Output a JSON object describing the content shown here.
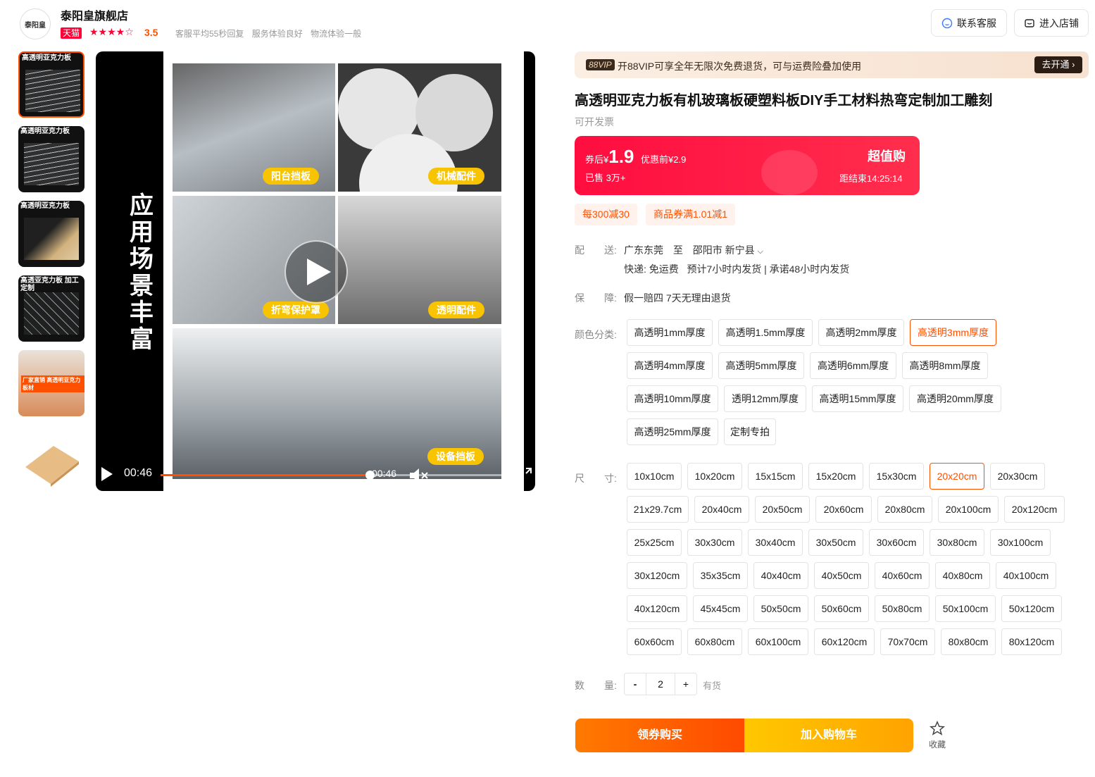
{
  "shop": {
    "logo_text": "泰阳皇",
    "name": "泰阳皇旗舰店",
    "badge": "天猫",
    "stars": "★★★★☆",
    "rating": "3.5",
    "service": [
      "客服平均55秒回复",
      "服务体验良好",
      "物流体验一般"
    ],
    "contact_label": "联系客服",
    "store_label": "进入店铺"
  },
  "thumbs": [
    {
      "title": "高透明亚克力板"
    },
    {
      "title": "高透明亚克力板"
    },
    {
      "title": "高透明亚克力板"
    },
    {
      "title": "高透亚克力板 加工定制"
    },
    {
      "title": "厂家直销 高透明亚克力板材"
    },
    {
      "title": ""
    }
  ],
  "video": {
    "side_title": "应用场景丰富",
    "labels": [
      "阳台挡板",
      "机械配件",
      "折弯保护罩",
      "透明配件",
      "设备挡板"
    ],
    "current_time": "00:46",
    "duration": "00:46",
    "progress": 0.6
  },
  "vip": {
    "tag": "88VIP",
    "text": "开88VIP可享全年无限次免费退货，可与运费险叠加使用",
    "button": "去开通 ›"
  },
  "product": {
    "title": "高透明亚克力板有机玻璃板硬塑料板DIY手工材料热弯定制加工雕刻",
    "invoice": "可开发票"
  },
  "price": {
    "after_label": "券后¥",
    "after_value": "1.9",
    "before": "优惠前¥2.9",
    "sold": "已售 3万+",
    "promo": "超值购",
    "countdown": "距结束14:25:14"
  },
  "coupons": [
    "每300减30",
    "商品券满1.01减1"
  ],
  "delivery": {
    "label": "配　　送:",
    "from": "广东东莞",
    "to_word": "至",
    "to": "邵阳市 新宁县",
    "detail": "快递: 免运费   预计7小时内发货 | 承诺48小时内发货"
  },
  "guarantee": {
    "label": "保　　障:",
    "value": "假一赔四 7天无理由退货"
  },
  "color": {
    "label": "颜色分类:",
    "options": [
      "高透明1mm厚度",
      "高透明1.5mm厚度",
      "高透明2mm厚度",
      "高透明3mm厚度",
      "高透明4mm厚度",
      "高透明5mm厚度",
      "高透明6mm厚度",
      "高透明8mm厚度",
      "高透明10mm厚度",
      "透明12mm厚度",
      "高透明15mm厚度",
      "高透明20mm厚度",
      "高透明25mm厚度",
      "定制专拍"
    ],
    "selected": "高透明3mm厚度"
  },
  "size": {
    "label": "尺　　寸:",
    "options": [
      "10x10cm",
      "10x20cm",
      "15x15cm",
      "15x20cm",
      "15x30cm",
      "20x20cm",
      "20x30cm",
      "21x29.7cm",
      "20x40cm",
      "20x50cm",
      "20x60cm",
      "20x80cm",
      "20x100cm",
      "20x120cm",
      "25x25cm",
      "30x30cm",
      "30x40cm",
      "30x50cm",
      "30x60cm",
      "30x80cm",
      "30x100cm",
      "30x120cm",
      "35x35cm",
      "40x40cm",
      "40x50cm",
      "40x60cm",
      "40x80cm",
      "40x100cm",
      "40x120cm",
      "45x45cm",
      "50x50cm",
      "50x60cm",
      "50x80cm",
      "50x100cm",
      "50x120cm",
      "60x60cm",
      "60x80cm",
      "60x100cm",
      "60x120cm",
      "70x70cm",
      "80x80cm",
      "80x120cm"
    ],
    "selected": "20x20cm"
  },
  "quantity": {
    "label": "数　　量:",
    "minus": "-",
    "value": "2",
    "plus": "+",
    "stock": "有货"
  },
  "actions": {
    "buy": "领券购买",
    "cart": "加入购物车",
    "favorite": "收藏"
  },
  "colors": {
    "accent": "#ff5000",
    "price_red": "#ff0d3f",
    "tmall_red": "#ff0036"
  }
}
